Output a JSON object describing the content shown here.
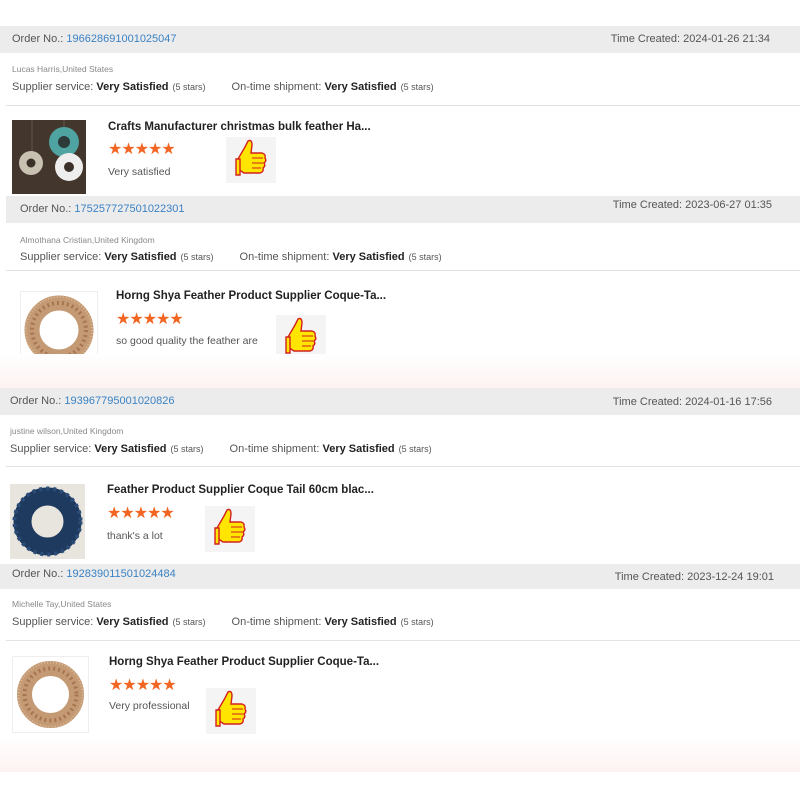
{
  "labels": {
    "order_no": "Order No.: ",
    "time_created": "Time Created: ",
    "supplier_service": "Supplier service: ",
    "on_time_shipment": "On-time shipment: ",
    "star_glyphs": "★★★★★"
  },
  "reviews": [
    {
      "order_no": "196628691001025047",
      "time": "2024-01-26 21:34",
      "buyer": "Lucas Harris,United States",
      "supplier_rating": "Very Satisfied",
      "supplier_stars": "(5 stars)",
      "shipment_rating": "Very Satisfied",
      "shipment_stars": "(5 stars)",
      "product": "Crafts Manufacturer christmas bulk feather Ha...",
      "stars": 5,
      "comment": "Very satisfied"
    },
    {
      "order_no": "175257727501022301",
      "time": "2023-06-27 01:35",
      "buyer": "Almothana Cristian,United Kingdom",
      "supplier_rating": "Very Satisfied",
      "supplier_stars": "(5 stars)",
      "shipment_rating": "Very Satisfied",
      "shipment_stars": "(5 stars)",
      "product": "Horng Shya Feather Product Supplier Coque-Ta...",
      "stars": 5,
      "comment": "so good quality the feather are"
    },
    {
      "order_no": "193967795001020826",
      "time": "2024-01-16 17:56",
      "buyer": "justine wilson,United Kingdom",
      "supplier_rating": "Very Satisfied",
      "supplier_stars": "(5 stars)",
      "shipment_rating": "Very Satisfied",
      "shipment_stars": "(5 stars)",
      "product": "Feather Product Supplier Coque Tail 60cm blac...",
      "stars": 5,
      "comment": "thank's a lot"
    },
    {
      "order_no": "192839011501024484",
      "time": "2023-12-24 19:01",
      "buyer": "Michelle Tay,United States",
      "supplier_rating": "Very Satisfied",
      "supplier_stars": "(5 stars)",
      "shipment_rating": "Very Satisfied",
      "shipment_stars": "(5 stars)",
      "product": "Horng Shya Feather Product Supplier Coque-Ta...",
      "stars": 5,
      "comment": "Very professional"
    }
  ],
  "colors": {
    "order_bar": "#ececec",
    "order_link": "#3b82c4",
    "star": "#f26522",
    "thumb_yellow": "#ffe500",
    "thumb_outline": "#d22020"
  }
}
